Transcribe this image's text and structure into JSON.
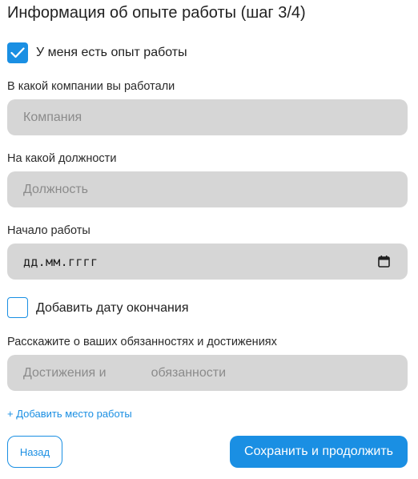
{
  "title": "Информация об опыте работы (шаг 3/4)",
  "experience_checkbox": {
    "label": "У меня есть опыт работы",
    "checked": true
  },
  "company": {
    "label": "В какой компании вы работали",
    "placeholder": "Компания"
  },
  "position": {
    "label": "На какой должности",
    "placeholder": "Должность"
  },
  "start_date": {
    "label": "Начало работы",
    "placeholder": "дд.мм.гггг",
    "icon": "calendar-icon"
  },
  "end_date_checkbox": {
    "label": "Добавить дату окончания",
    "checked": false
  },
  "duties": {
    "label": "Расскажите о ваших обязанностях и достижениях",
    "placeholder_part1": "Достижения и",
    "placeholder_part2": "обязанности"
  },
  "add_workplace_link": "+ Добавить место работы",
  "buttons": {
    "back": "Назад",
    "save": "Сохранить и продолжить"
  },
  "colors": {
    "accent": "#1a8fe3",
    "input_bg": "#d6d6d6",
    "placeholder": "#8b8b8b"
  }
}
